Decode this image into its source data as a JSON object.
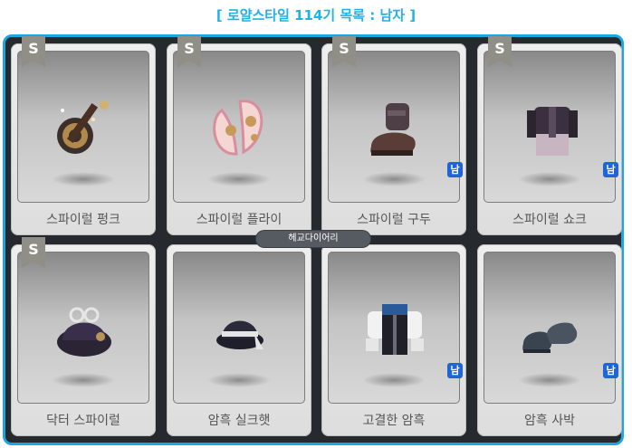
{
  "title": "[ 로얄스타일 114기 목록 : 남자 ]",
  "tooltip": "헤교다이어리",
  "badge_male": "남",
  "rank_letter": "S",
  "items": [
    {
      "name": "스파이럴 펑크",
      "icon": "spiral-punk-weapon-icon",
      "rank": true,
      "male": false
    },
    {
      "name": "스파이럴 플라이",
      "icon": "spiral-fly-wing-icon",
      "rank": true,
      "male": false
    },
    {
      "name": "스파이럴 구두",
      "icon": "spiral-shoes-icon",
      "rank": true,
      "male": true
    },
    {
      "name": "스파이럴 쇼크",
      "icon": "spiral-shock-outfit-icon",
      "rank": true,
      "male": true
    },
    {
      "name": "닥터 스파이럴",
      "icon": "doctor-spiral-hat-icon",
      "rank": true,
      "male": false
    },
    {
      "name": "암흑 실크햇",
      "icon": "dark-silk-hat-icon",
      "rank": false,
      "male": false
    },
    {
      "name": "고결한 암흑",
      "icon": "noble-dark-outfit-icon",
      "rank": false,
      "male": true
    },
    {
      "name": "암흑 사박",
      "icon": "dark-shoes-icon",
      "rank": false,
      "male": true
    }
  ],
  "colors": {
    "accent": "#1aa6e0",
    "frame_bg": "#26292d",
    "badge": "#1c66d8"
  }
}
